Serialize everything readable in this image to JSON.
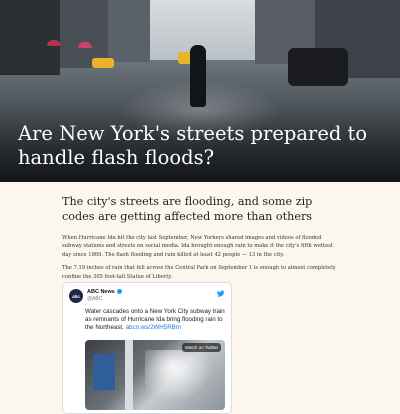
{
  "hero": {
    "title": "Are New York's streets prepared to handle flash floods?"
  },
  "article": {
    "subhead": "The city's streets are flooding, and some zip codes are getting affected more than others",
    "paragraphs": [
      "When Hurricane Ida hit the city last September, New Yorkers shared images and videos of flooded subway stations and streets on social media. Ida brought enough rain to make it the city's fifth wettest day since 1869. The flash flooding and rain killed at least 42 people — 13 in the city.",
      "The 7.19 inches of rain that fell across the Central Park on September 1 is enough to almost completely confine the 305 foot-tall Statue of Liberty."
    ]
  },
  "tweet": {
    "avatar_text": "abc",
    "name": "ABC News",
    "handle": "@ABC",
    "text": "Water cascades onto a New York City subway train as remnants of Hurricane Ida bring flooding rain to the Northeast.",
    "link": "abcn.ws/2WH5RBm",
    "watch_label": "Watch on Twitter",
    "icon": "twitter-bird-icon",
    "accent": "#1d9bf0"
  }
}
